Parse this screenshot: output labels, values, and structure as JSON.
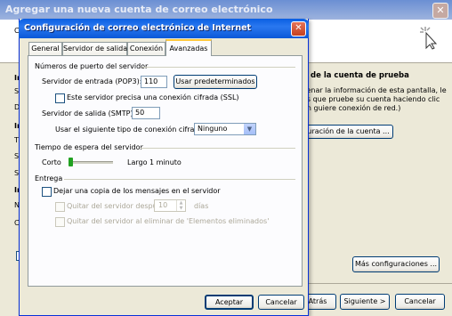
{
  "background_window": {
    "title": "Agregar una nueva cuenta de correo electrónico",
    "close_glyph": "✕",
    "left_letters": [
      "C",
      "In",
      "Su",
      "Di",
      "In",
      "Tip",
      "Se",
      "Se",
      "In",
      "No",
      "Co"
    ],
    "right_panel": {
      "title": "n de la cuenta de prueba",
      "description": "llenar la información de esta pantalla, le os que pruebe su cuenta haciendo clic en guiere conexión de red.)",
      "test_button": "guración de la cuenta ...",
      "more_settings_button": "Más configuraciones ..."
    },
    "footer": {
      "back": "Atrás",
      "next": "Siguiente >",
      "cancel": "Cancelar"
    }
  },
  "dialog": {
    "title": "Configuración de correo electrónico de Internet",
    "close_glyph": "✕",
    "tabs": [
      "General",
      "Servidor de salida",
      "Conexión",
      "Avanzadas"
    ],
    "active_tab": "Avanzadas",
    "ports_group": {
      "label": "Números de puerto del servidor",
      "incoming_label": "Servidor de entrada (POP3):",
      "incoming_value": "110",
      "defaults_button": "Usar predeterminados",
      "ssl_label": "Este servidor precisa una conexión cifrada (SSL)",
      "ssl_checked": false,
      "outgoing_label": "Servidor de salida (SMTP):",
      "outgoing_value": "50",
      "encryption_label": "Usar el siguiente tipo de conexión cifrada:",
      "encryption_value": "Ninguno",
      "dropdown_glyph": "▼"
    },
    "timeout_group": {
      "label": "Tiempo de espera del servidor",
      "short_label": "Corto",
      "long_label": "Largo",
      "value_text": "1 minuto",
      "slider_level": 0.0
    },
    "delivery_group": {
      "label": "Entrega",
      "keep_copy_label": "Dejar una copia de los mensajes en el servidor",
      "keep_copy_checked": false,
      "remove_after_label": "Quitar del servidor después",
      "remove_after_value": "10",
      "days_label": "días",
      "remove_on_delete_label": "Quitar del servidor al eliminar de 'Elementos eliminados'"
    },
    "buttons": {
      "ok": "Aceptar",
      "cancel": "Cancelar"
    }
  }
}
